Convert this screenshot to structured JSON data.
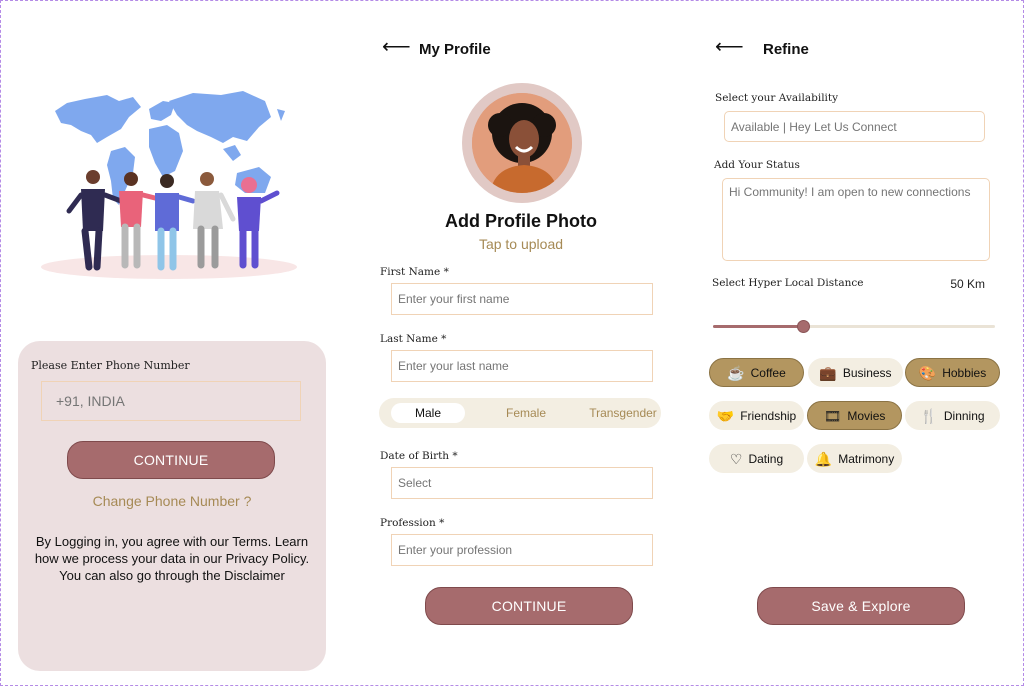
{
  "login": {
    "phone_label": "Please Enter Phone Number",
    "phone_placeholder": "+91, INDIA",
    "continue_label": "CONTINUE",
    "change_phone_label": "Change Phone Number ?",
    "terms_text": "By Logging in, you agree with our Terms. Learn how we process your data in our Privacy Policy. You can also go through the Disclaimer"
  },
  "profile": {
    "title": "My Profile",
    "add_photo_label": "Add Profile Photo",
    "tap_upload_label": "Tap to upload",
    "first_name": {
      "label": "First Name  *",
      "placeholder": "Enter your first name"
    },
    "last_name": {
      "label": "Last Name  *",
      "placeholder": "Enter your last name"
    },
    "gender_options": [
      "Male",
      "Female",
      "Transgender"
    ],
    "gender_selected": "Male",
    "dob": {
      "label": "Date of Birth  *",
      "placeholder": "Select"
    },
    "profession": {
      "label": "Profession  *",
      "placeholder": "Enter your profession"
    },
    "continue_label": "CONTINUE"
  },
  "refine": {
    "title": "Refine",
    "availability": {
      "label": "Select your Availability",
      "placeholder": "Available | Hey Let Us Connect"
    },
    "status": {
      "label": "Add Your Status",
      "placeholder": "Hi Community! I am open to new connections"
    },
    "distance": {
      "label": "Select Hyper Local Distance",
      "value": "50 Km",
      "slider_fraction": 0.32
    },
    "interests": [
      {
        "label": "Coffee",
        "icon": "coffee-cup-icon",
        "glyph": "☕",
        "selected": true
      },
      {
        "label": "Business",
        "icon": "briefcase-icon",
        "glyph": "💼",
        "selected": false
      },
      {
        "label": "Hobbies",
        "icon": "palette-icon",
        "glyph": "🎨",
        "selected": true
      },
      {
        "label": "Friendship",
        "icon": "handshake-icon",
        "glyph": "🤝",
        "selected": false
      },
      {
        "label": "Movies",
        "icon": "film-icon",
        "glyph": "🎞",
        "selected": true
      },
      {
        "label": "Dinning",
        "icon": "dining-icon",
        "glyph": "🍴",
        "selected": false
      },
      {
        "label": "Dating",
        "icon": "heart-icon",
        "glyph": "♡",
        "selected": false
      },
      {
        "label": "Matrimony",
        "icon": "bell-icon",
        "glyph": "🔔",
        "selected": false
      }
    ],
    "save_label": "Save & Explore"
  },
  "colors": {
    "primary_button": "#a66b6d",
    "accent_text": "#a68a55",
    "selected_chip": "#b39660",
    "chip_background": "#f3eee2",
    "login_card": "#ecdfe0",
    "input_border": "#f0d3b6"
  }
}
